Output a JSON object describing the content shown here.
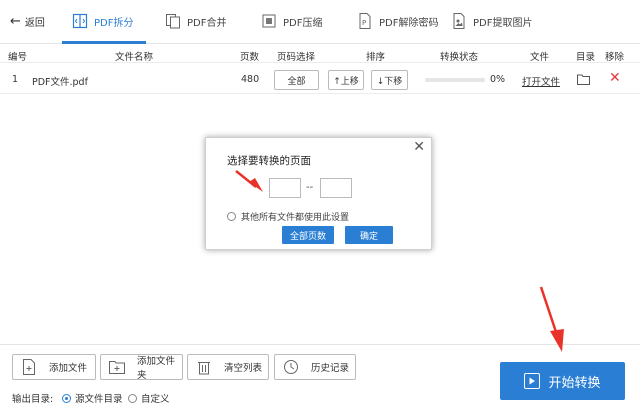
{
  "topbar": {
    "back_label": "返回",
    "tabs": [
      {
        "label": "PDF拆分",
        "icon": "split-icon",
        "active": true
      },
      {
        "label": "PDF合并",
        "icon": "merge-icon",
        "active": false
      },
      {
        "label": "PDF压缩",
        "icon": "compress-icon",
        "active": false
      },
      {
        "label": "PDF解除密码",
        "icon": "unlock-icon",
        "active": false
      },
      {
        "label": "PDF提取图片",
        "icon": "extract-image-icon",
        "active": false
      }
    ]
  },
  "table": {
    "headers": {
      "no": "编号",
      "name": "文件名称",
      "pages": "页数",
      "page_select": "页码选择",
      "order": "排序",
      "status": "转换状态",
      "file": "文件",
      "dir": "目录",
      "remove": "移除"
    },
    "rows": [
      {
        "no": "1",
        "name": "PDF文件.pdf",
        "pages": "480",
        "page_select": "全部",
        "move_up": "↑上移",
        "move_down": "↓下移",
        "progress": 0,
        "progress_text": "0%",
        "open_file": "打开文件"
      }
    ]
  },
  "dialog": {
    "title": "选择要转换的页面",
    "from_value": "",
    "to_value": "",
    "separator": "--",
    "apply_all_label": "其他所有文件都使用此设置",
    "all_pages_button": "全部页数",
    "confirm_button": "确定"
  },
  "bottom": {
    "add_file": "添加文件",
    "add_folder": "添加文件夹",
    "clear_list": "清空列表",
    "history": "历史记录",
    "output_label": "输出目录:",
    "option_source": "源文件目录",
    "option_custom": "自定义",
    "start_button": "开始转换"
  },
  "colors": {
    "accent": "#2a7fd4",
    "remove": "#e63a3a",
    "annotation_arrow": "#e8322a"
  }
}
